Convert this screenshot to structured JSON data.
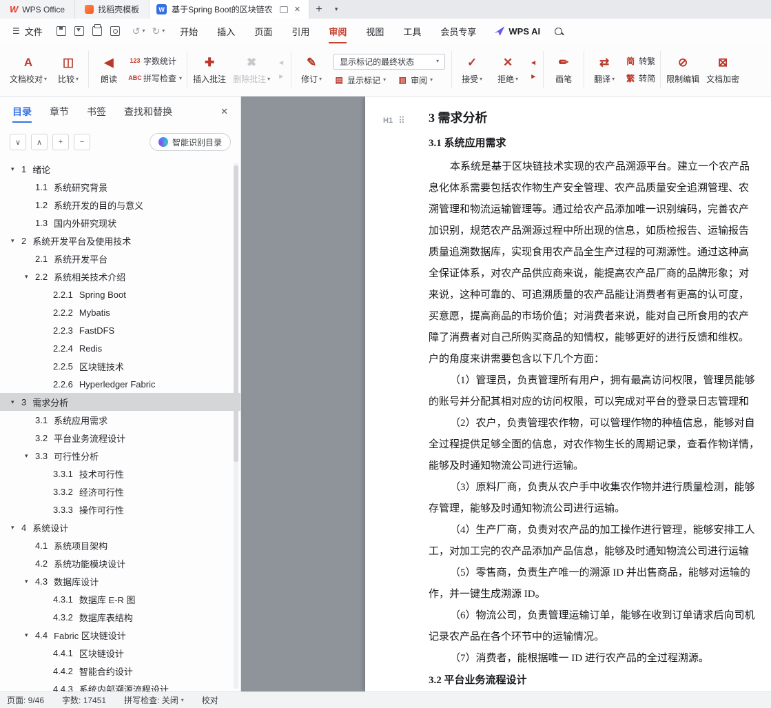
{
  "window": {
    "app_tabs": [
      {
        "id": "wps-office",
        "label": "WPS Office"
      },
      {
        "id": "docer-templates",
        "label": "找稻壳模板"
      }
    ],
    "doc_tab": {
      "label": "基于Spring Boot的区块链农"
    },
    "new_tab_glyph": "+",
    "tab_list_glyph": "▾"
  },
  "menubar": {
    "file_label": "文件",
    "menus": [
      {
        "id": "start",
        "label": "开始"
      },
      {
        "id": "insert",
        "label": "插入"
      },
      {
        "id": "page",
        "label": "页面"
      },
      {
        "id": "reference",
        "label": "引用"
      },
      {
        "id": "review",
        "label": "审阅",
        "active": true
      },
      {
        "id": "view",
        "label": "视图"
      },
      {
        "id": "tools",
        "label": "工具"
      },
      {
        "id": "member",
        "label": "会员专享"
      }
    ],
    "wps_ai_label": "WPS AI"
  },
  "ribbon": {
    "select_value": "显示标记的最终状态",
    "rev_rows": [
      {
        "icon": "show-markup",
        "label": "显示标记",
        "dd": true
      },
      {
        "icon": "review-pane",
        "label": "审阅",
        "dd": true
      }
    ],
    "glyphs": {
      "proofread": "A",
      "compare": "◫",
      "read-aloud": "◀",
      "word-count": "123",
      "spell-check": "ABC",
      "insert-comment": "✚",
      "delete-comment": "✖",
      "prev-comment": "◂",
      "next-comment": "▸",
      "track-changes": "✎",
      "show-markup": "▤",
      "review-pane": "▥",
      "accept": "✓",
      "reject": "✕",
      "prev-change": "◂",
      "next-change": "▸",
      "brush": "✏",
      "translate": "⇄",
      "to-traditional": "简",
      "to-simplified": "繁",
      "restrict-edit": "⊘",
      "encrypt": "⊠"
    },
    "groups": [
      [
        {
          "k": "big",
          "icon": "proofread",
          "label": "文档校对",
          "dd": true
        },
        {
          "k": "big",
          "icon": "compare",
          "label": "比较",
          "dd": true
        }
      ],
      [
        {
          "k": "big",
          "icon": "read-aloud",
          "label": "朗读"
        },
        {
          "k": "col",
          "rows": [
            {
              "icon": "word-count",
              "label": "字数统计"
            },
            {
              "icon": "spell-check",
              "label": "拼写检查",
              "dd": true
            }
          ]
        }
      ],
      [
        {
          "k": "big",
          "icon": "insert-comment",
          "label": "插入批注"
        },
        {
          "k": "big",
          "icon": "delete-comment",
          "label": "删除批注",
          "dd": true,
          "disabled": true
        },
        {
          "k": "mini",
          "rows": [
            {
              "icon": "prev-comment",
              "disabled": true
            },
            {
              "icon": "next-comment",
              "disabled": true
            }
          ]
        }
      ],
      [
        {
          "k": "big",
          "icon": "track-changes",
          "label": "修订",
          "dd": true
        },
        {
          "k": "rev"
        }
      ],
      [
        {
          "k": "big",
          "icon": "accept",
          "label": "接受",
          "dd": true
        },
        {
          "k": "big",
          "icon": "reject",
          "label": "拒绝",
          "dd": true
        },
        {
          "k": "mini",
          "rows": [
            {
              "icon": "prev-change"
            },
            {
              "icon": "next-change"
            }
          ]
        }
      ],
      [
        {
          "k": "big",
          "icon": "brush",
          "label": "画笔"
        }
      ],
      [
        {
          "k": "big",
          "icon": "translate",
          "label": "翻译",
          "dd": true
        },
        {
          "k": "col",
          "rows": [
            {
              "icon": "to-traditional",
              "label": "转繁"
            },
            {
              "icon": "to-simplified",
              "label": "转简"
            }
          ]
        }
      ],
      [
        {
          "k": "big",
          "icon": "restrict-edit",
          "label": "限制编辑"
        },
        {
          "k": "big",
          "icon": "encrypt",
          "label": "文档加密"
        }
      ]
    ]
  },
  "sidebar": {
    "tabs": [
      {
        "id": "toc",
        "label": "目录",
        "active": true
      },
      {
        "id": "chapter",
        "label": "章节"
      },
      {
        "id": "bookmark",
        "label": "书签"
      },
      {
        "id": "find-replace",
        "label": "查找和替换"
      }
    ],
    "close_glyph": "✕",
    "controls": [
      {
        "id": "collapse-all",
        "glyph": "∨"
      },
      {
        "id": "expand-all",
        "glyph": "∧"
      },
      {
        "id": "expand-more",
        "glyph": "+"
      },
      {
        "id": "collapse-more",
        "glyph": "−"
      }
    ],
    "smart_button": "智能识别目录",
    "toc": [
      {
        "level": 1,
        "num": "1",
        "label": "绪论",
        "children": true
      },
      {
        "level": 2,
        "num": "1.1",
        "label": "系统研究背景"
      },
      {
        "level": 2,
        "num": "1.2",
        "label": "系统开发的目的与意义"
      },
      {
        "level": 2,
        "num": "1.3",
        "label": "国内外研究现状"
      },
      {
        "level": 1,
        "num": "2",
        "label": "系统开发平台及使用技术",
        "children": true
      },
      {
        "level": 2,
        "num": "2.1",
        "label": "系统开发平台"
      },
      {
        "level": 2,
        "num": "2.2",
        "label": "系统相关技术介绍",
        "children": true
      },
      {
        "level": 3,
        "num": "2.2.1",
        "label": "Spring Boot"
      },
      {
        "level": 3,
        "num": "2.2.2",
        "label": "Mybatis"
      },
      {
        "level": 3,
        "num": "2.2.3",
        "label": "FastDFS"
      },
      {
        "level": 3,
        "num": "2.2.4",
        "label": "Redis"
      },
      {
        "level": 3,
        "num": "2.2.5",
        "label": "区块链技术"
      },
      {
        "level": 3,
        "num": "2.2.6",
        "label": "Hyperledger Fabric"
      },
      {
        "level": 1,
        "num": "3",
        "label": "需求分析",
        "children": true,
        "selected": true
      },
      {
        "level": 2,
        "num": "3.1",
        "label": "系统应用需求"
      },
      {
        "level": 2,
        "num": "3.2",
        "label": "平台业务流程设计"
      },
      {
        "level": 2,
        "num": "3.3",
        "label": "可行性分析",
        "children": true
      },
      {
        "level": 3,
        "num": "3.3.1",
        "label": "技术可行性"
      },
      {
        "level": 3,
        "num": "3.3.2",
        "label": "经济可行性"
      },
      {
        "level": 3,
        "num": "3.3.3",
        "label": "操作可行性"
      },
      {
        "level": 1,
        "num": "4",
        "label": "系统设计",
        "children": true
      },
      {
        "level": 2,
        "num": "4.1",
        "label": "系统项目架构"
      },
      {
        "level": 2,
        "num": "4.2",
        "label": "系统功能模块设计"
      },
      {
        "level": 2,
        "num": "4.3",
        "label": "数据库设计",
        "children": true
      },
      {
        "level": 3,
        "num": "4.3.1",
        "label": "数据库 E-R 图"
      },
      {
        "level": 3,
        "num": "4.3.2",
        "label": "数据库表结构"
      },
      {
        "level": 2,
        "num": "4.4",
        "label": "Fabric 区块链设计",
        "children": true
      },
      {
        "level": 3,
        "num": "4.4.1",
        "label": "区块链设计"
      },
      {
        "level": 3,
        "num": "4.4.2",
        "label": "智能合约设计"
      },
      {
        "level": 3,
        "num": "4.4.3",
        "label": "系统内部溯源流程设计"
      }
    ]
  },
  "document": {
    "heading_badge": "H1",
    "drag_glyph": "⠿",
    "blocks": [
      {
        "t": "h1",
        "text": "3  需求分析"
      },
      {
        "t": "h2",
        "text": "3.1  系统应用需求"
      },
      {
        "t": "line",
        "indent": true,
        "text": "本系统是基于区块链技术实现的农产品溯源平台。建立一个农产品"
      },
      {
        "t": "line",
        "text": "息化体系需要包括农作物生产安全管理、农产品质量安全追溯管理、农"
      },
      {
        "t": "line",
        "text": "溯管理和物流运输管理等。通过给农产品添加唯一识别编码，完善农产"
      },
      {
        "t": "line",
        "text": "加识别，规范农产品溯源过程中所出现的信息，如质检报告、运输报告"
      },
      {
        "t": "line",
        "text": "质量追溯数据库，实现食用农产品全生产过程的可溯源性。通过这种高"
      },
      {
        "t": "line",
        "text": "全保证体系，对农产品供应商来说，能提高农产品厂商的品牌形象；对"
      },
      {
        "t": "line",
        "text": "来说，这种可靠的、可追溯质量的农产品能让消费者有更高的认可度，"
      },
      {
        "t": "line",
        "text": "买意愿，提高商品的市场价值；对消费者来说，能对自己所食用的农产"
      },
      {
        "t": "line",
        "text": "障了消费者对自己所购买商品的知情权，能够更好的进行反馈和维权。"
      },
      {
        "t": "line",
        "text": "户的角度来讲需要包含以下几个方面："
      },
      {
        "t": "line",
        "indent": true,
        "text": "（1）管理员，负责管理所有用户，拥有最高访问权限，管理员能够"
      },
      {
        "t": "line",
        "text": "的账号并分配其相对应的访问权限，可以完成对平台的登录日志管理和"
      },
      {
        "t": "line",
        "indent": true,
        "text": "（2）农户，负责管理农作物，可以管理作物的种植信息，能够对自"
      },
      {
        "t": "line",
        "text": "全过程提供足够全面的信息，对农作物生长的周期记录，查看作物详情，"
      },
      {
        "t": "line",
        "text": "能够及时通知物流公司进行运输。"
      },
      {
        "t": "line",
        "indent": true,
        "text": "（3）原料厂商，负责从农户手中收集农作物并进行质量检测，能够"
      },
      {
        "t": "line",
        "text": "存管理，能够及时通知物流公司进行运输。"
      },
      {
        "t": "line",
        "indent": true,
        "text": "（4）生产厂商，负责对农产品的加工操作进行管理，能够安排工人"
      },
      {
        "t": "line",
        "text": "工，对加工完的农产品添加产品信息，能够及时通知物流公司进行运输"
      },
      {
        "t": "line",
        "indent": true,
        "text": "（5）零售商，负责生产唯一的溯源 ID 并出售商品，能够对运输的"
      },
      {
        "t": "line",
        "text": "作，并一键生成溯源 ID。"
      },
      {
        "t": "line",
        "indent": true,
        "text": "（6）物流公司，负责管理运输订单，能够在收到订单请求后向司机"
      },
      {
        "t": "line",
        "text": "记录农产品在各个环节中的运输情况。"
      },
      {
        "t": "line",
        "indent": true,
        "text": "（7）消费者，能根据唯一 ID 进行农产品的全过程溯源。"
      },
      {
        "t": "h2",
        "text": "3.2  平台业务流程设计"
      }
    ]
  },
  "statusbar": {
    "items": [
      {
        "id": "page",
        "label": "页面: 9/46"
      },
      {
        "id": "words",
        "label": "字数: 17451"
      },
      {
        "id": "spellcheck",
        "label": "拼写检查: 关闭",
        "dd": true
      },
      {
        "id": "proofread",
        "label": "校对"
      }
    ]
  },
  "colors": {
    "accent_red": "#c5402e",
    "accent_blue": "#3672e9",
    "canvas_gray": "#8f949b",
    "toc_selected_gray": "#d5d6d8"
  }
}
